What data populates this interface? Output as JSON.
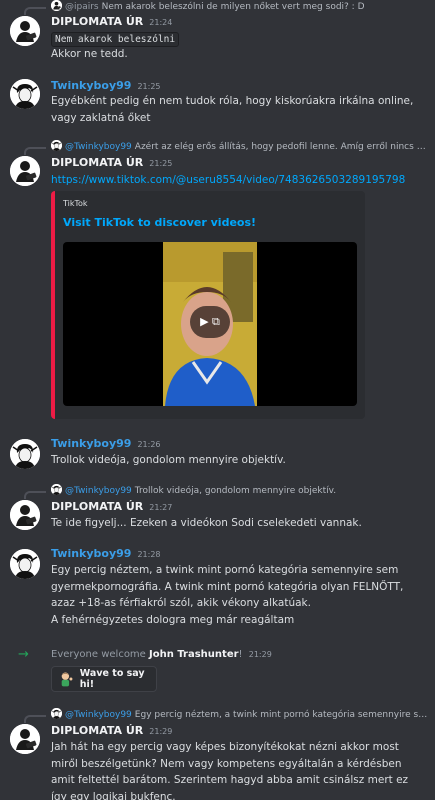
{
  "messages": [
    {
      "reply": {
        "mention": "@ipairs",
        "text": "Nem akarok beleszólni de milyen nőket vert meg sodi? : D"
      },
      "author": "DIPLOMATA ÚR",
      "time": "21:24",
      "code": "Nem akarok beleszólni",
      "text": "Akkor ne tedd."
    },
    {
      "author": "Twinkyboy99",
      "time": "21:25",
      "text": "Egyébként pedig én nem tudok róla, hogy kiskorúakra irkálna online, vagy zaklatná őket"
    },
    {
      "reply": {
        "mention": "@Twinkyboy99",
        "text": "Azért az elég erős állítás, hogy pedofil lenne. Amíg erről nincs bizonyíték, addig…"
      },
      "author": "DIPLOMATA ÚR",
      "time": "21:25",
      "link": "https://www.tiktok.com/@useru8554/video/7483626503289195798",
      "embed": {
        "provider": "TikTok",
        "title": "Visit TikTok to discover videos!"
      }
    },
    {
      "author": "Twinkyboy99",
      "time": "21:26",
      "text": "Trollok videója, gondolom mennyire objektív."
    },
    {
      "reply": {
        "mention": "@Twinkyboy99",
        "text": "Trollok videója, gondolom mennyire objektív."
      },
      "author": "DIPLOMATA ÚR",
      "time": "21:27",
      "text": "Te ide figyelj... Ezeken a videókon Sodi cselekedeti vannak."
    },
    {
      "author": "Twinkyboy99",
      "time": "21:28",
      "text": "Egy percig néztem, a twink mint pornó kategória semennyire sem gyermekpornográfia. A twink mint pornó kategória olyan FELNŐTT, azaz +18-as férfiakról szól, akik vékony alkatúak.",
      "text2": "A fehérnégyzetes dologra meg már reagáltam"
    },
    {
      "reply": {
        "mention": "@Twinkyboy99",
        "text": "Egy percig néztem, a twink mint pornó kategória semennyire sem gyermekpornográfia…"
      },
      "author": "DIPLOMATA ÚR",
      "time": "21:29",
      "text": "Jah hát ha egy percig vagy képes bizonyítékokat nézni akkor most miről beszélgetünk? Nem vagy kompetens egyáltalán a kérdésben amit feltettél barátom. Szerintem hagyd abba amit csinálsz mert ez így egy logikai bukfenc."
    }
  ],
  "system": {
    "prefix": "Everyone welcome",
    "name": "John Trashunter",
    "suffix": "!",
    "time": "21:29",
    "wave_label": "Wave to say hi!"
  },
  "colors": {
    "background": "#313338",
    "username_twinky": "#3b9ee8",
    "link": "#00a8fc",
    "embed_accent": "#ed1c45",
    "join_arrow": "#23a55a"
  },
  "icons": {
    "join": "arrow-right-icon",
    "wave": "wave-sticker-icon",
    "play": "play-icon"
  }
}
